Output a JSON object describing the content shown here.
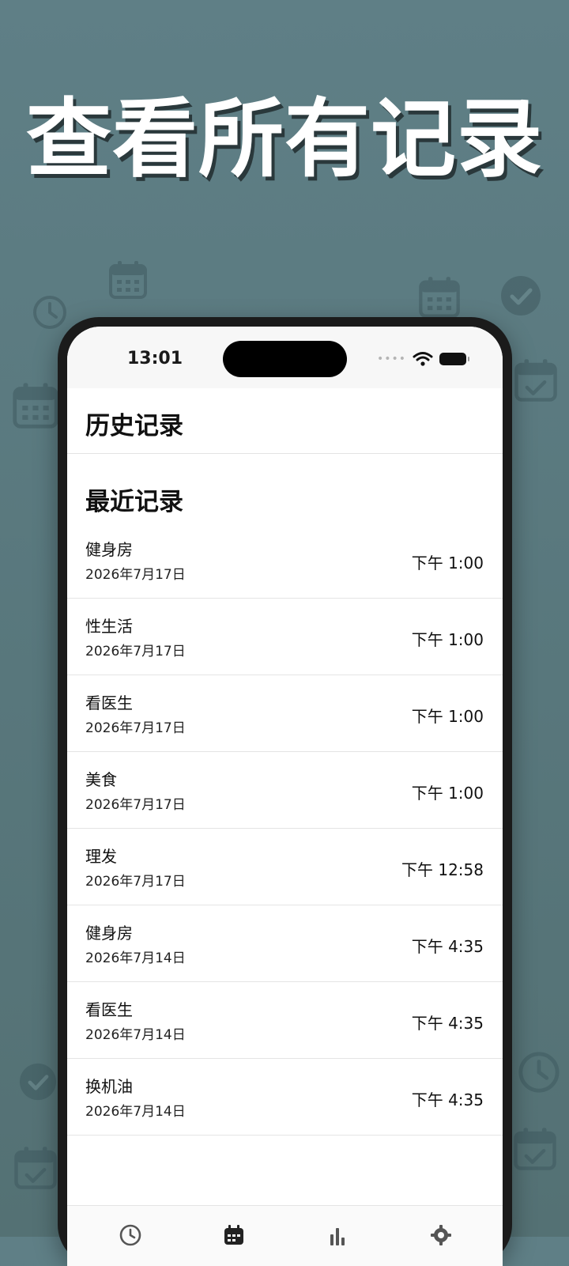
{
  "promo": {
    "headline": "查看所有记录"
  },
  "status_bar": {
    "time": "13:01",
    "signal": "••••"
  },
  "nav": {
    "title": "历史记录"
  },
  "section": {
    "title": "最近记录"
  },
  "records": [
    {
      "title": "健身房",
      "date": "2026年7月17日",
      "time": "下午 1:00"
    },
    {
      "title": "性生活",
      "date": "2026年7月17日",
      "time": "下午 1:00"
    },
    {
      "title": "看医生",
      "date": "2026年7月17日",
      "time": "下午 1:00"
    },
    {
      "title": "美食",
      "date": "2026年7月17日",
      "time": "下午 1:00"
    },
    {
      "title": "理发",
      "date": "2026年7月17日",
      "time": "下午 12:58"
    },
    {
      "title": "健身房",
      "date": "2026年7月14日",
      "time": "下午 4:35"
    },
    {
      "title": "看医生",
      "date": "2026年7月14日",
      "time": "下午 4:35"
    },
    {
      "title": "换机油",
      "date": "2026年7月14日",
      "time": "下午 4:35"
    }
  ],
  "tab_bar": {
    "tabs": [
      {
        "icon": "clock-icon"
      },
      {
        "icon": "calendar-icon",
        "selected": true
      },
      {
        "icon": "bar-chart-icon"
      },
      {
        "icon": "gear-icon"
      }
    ]
  },
  "colors": {
    "background": "#5f7f86",
    "icon_tint": "#3f5a60",
    "text": "#111111"
  }
}
